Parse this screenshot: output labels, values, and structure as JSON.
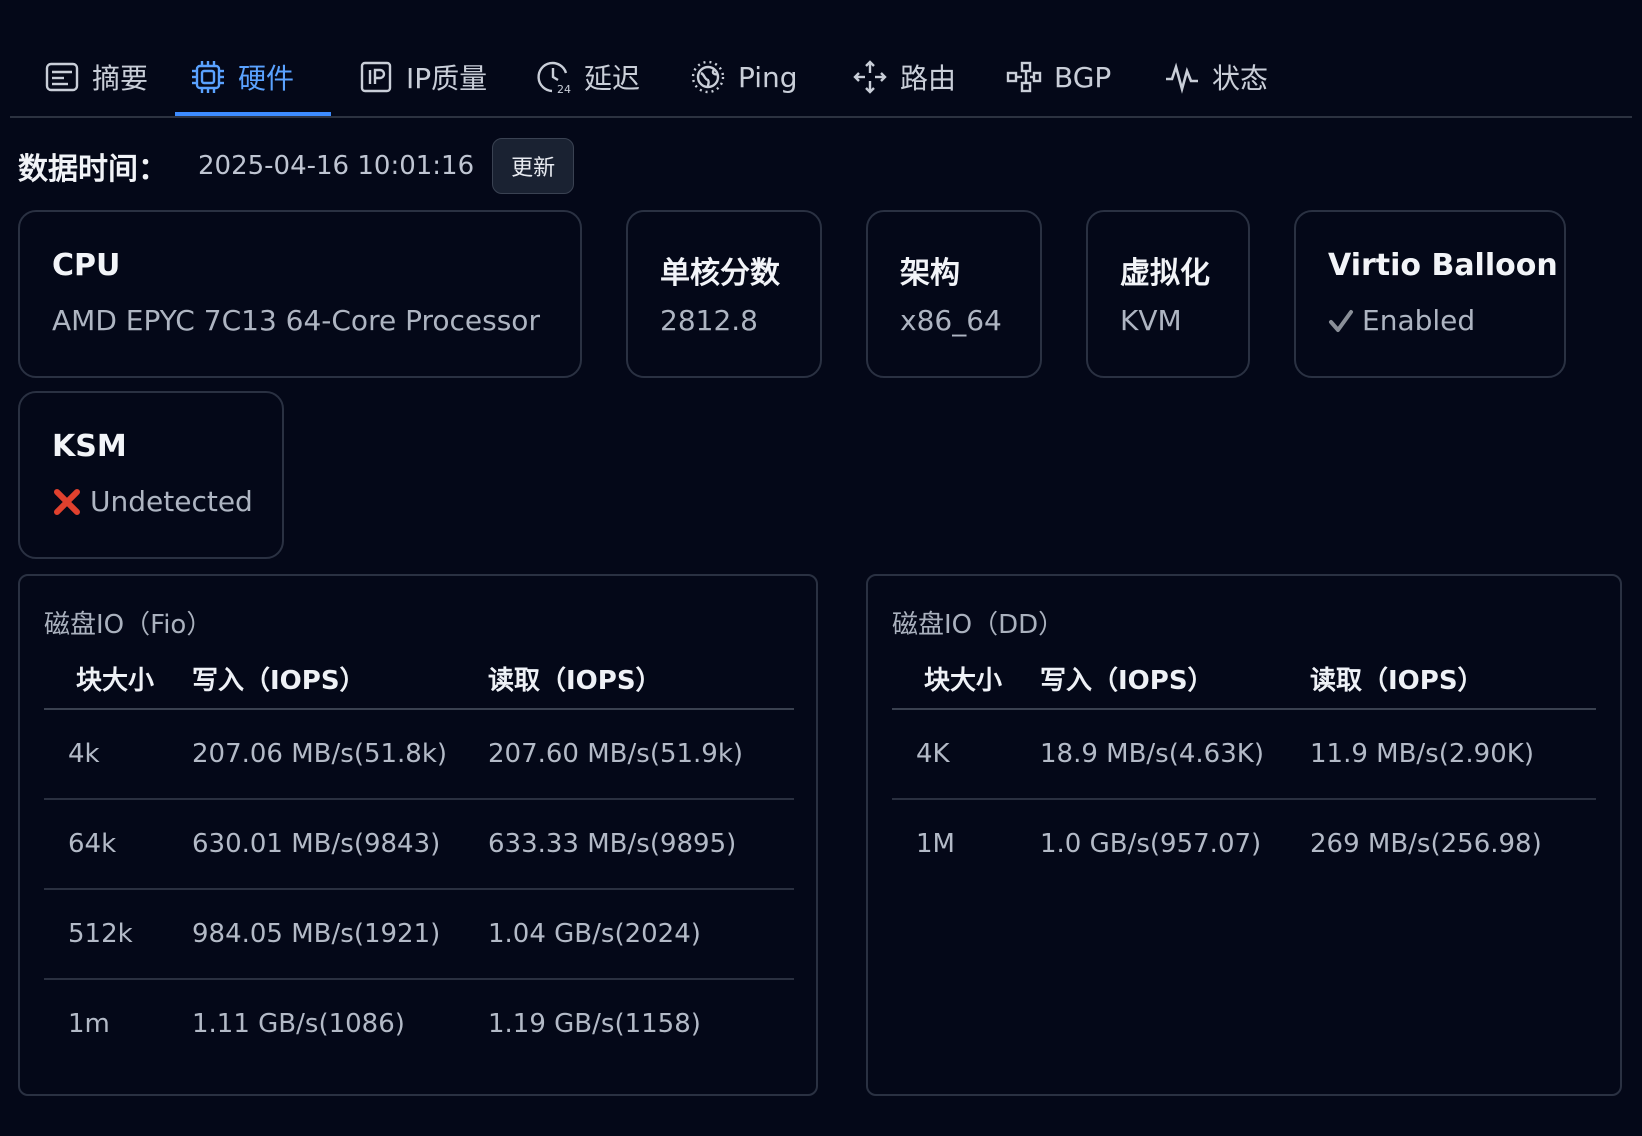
{
  "tabs": [
    {
      "label": "摘要",
      "icon": "summary-icon"
    },
    {
      "label": "硬件",
      "icon": "chip-icon"
    },
    {
      "label": "IP质量",
      "icon": "ip-icon"
    },
    {
      "label": "延迟",
      "icon": "clock-24-icon"
    },
    {
      "label": "Ping",
      "icon": "globe-icon"
    },
    {
      "label": "路由",
      "icon": "route-icon"
    },
    {
      "label": "BGP",
      "icon": "bgp-icon"
    },
    {
      "label": "状态",
      "icon": "pulse-icon"
    }
  ],
  "active_tab": "硬件",
  "meta": {
    "label": "数据时间：",
    "value": "2025-04-16 10:01:16",
    "refresh_label": "更新"
  },
  "cards": {
    "cpu": {
      "title": "CPU",
      "value": "AMD EPYC 7C13 64-Core Processor"
    },
    "single_core": {
      "title": "单核分数",
      "value": "2812.8"
    },
    "arch": {
      "title": "架构",
      "value": "x86_64"
    },
    "virt": {
      "title": "虚拟化",
      "value": "KVM"
    },
    "balloon": {
      "title": "Virtio Balloon",
      "value": "Enabled",
      "status_icon": "check-icon"
    },
    "ksm": {
      "title": "KSM",
      "value": "Undetected",
      "status_icon": "cross-icon"
    }
  },
  "fio": {
    "title": "磁盘IO（Fio）",
    "headers": [
      "块大小",
      "写入（IOPS）",
      "读取（IOPS）"
    ],
    "rows": [
      [
        "4k",
        "207.06 MB/s(51.8k)",
        "207.60 MB/s(51.9k)"
      ],
      [
        "64k",
        "630.01 MB/s(9843)",
        "633.33 MB/s(9895)"
      ],
      [
        "512k",
        "984.05 MB/s(1921)",
        "1.04 GB/s(2024)"
      ],
      [
        "1m",
        "1.11 GB/s(1086)",
        "1.19 GB/s(1158)"
      ]
    ]
  },
  "dd": {
    "title": "磁盘IO（DD）",
    "headers": [
      "块大小",
      "写入（IOPS）",
      "读取（IOPS）"
    ],
    "rows": [
      [
        "4K",
        "18.9 MB/s(4.63K)",
        "11.9 MB/s(2.90K)"
      ],
      [
        "1M",
        "1.0 GB/s(957.07)",
        "269 MB/s(256.98)"
      ]
    ]
  },
  "colors": {
    "accent": "#3d8bff",
    "background": "#040818",
    "check": "#8a8f98",
    "cross": "#e0412e"
  }
}
